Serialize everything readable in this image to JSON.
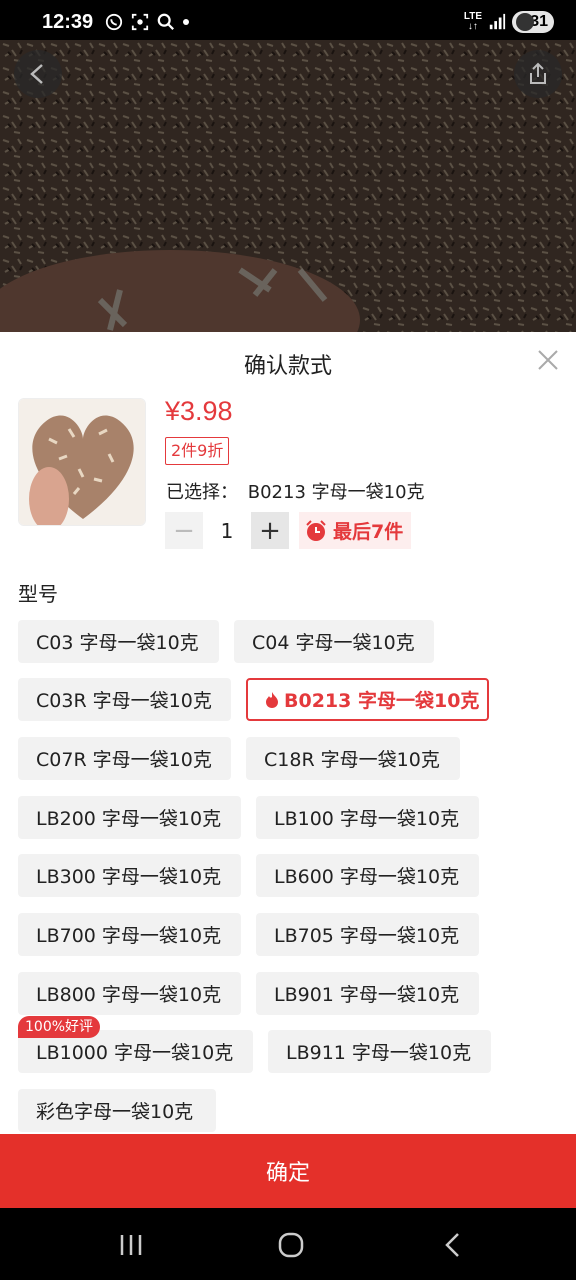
{
  "status": {
    "time": "12:39",
    "network": "LTE",
    "battery": "31",
    "icons_left": [
      "whatsapp-icon",
      "screenshot-icon",
      "search-icon",
      "dot-icon"
    ],
    "icons_right": [
      "lte-icon",
      "signal-icon",
      "battery-icon"
    ]
  },
  "hero": {
    "back_icon": "chevron-left-icon",
    "share_icon": "share-icon"
  },
  "sheet": {
    "title": "确认款式",
    "close_icon": "close-icon",
    "price": "¥3.98",
    "discount": "2件9折",
    "selected_label": "已选择：",
    "selected_value": "B0213 字母一袋10克",
    "quantity": "1",
    "minus_label": "−",
    "plus_label": "+",
    "stock": "最后7件",
    "section_label": "型号",
    "options": [
      {
        "label": "C03 字母一袋10克"
      },
      {
        "label": "C04 字母一袋10克"
      },
      {
        "label": "C03R 字母一袋10克"
      },
      {
        "label": "B0213 字母一袋10克",
        "selected": true
      },
      {
        "label": "C07R 字母一袋10克"
      },
      {
        "label": "C18R 字母一袋10克"
      },
      {
        "label": "LB200 字母一袋10克"
      },
      {
        "label": "LB100 字母一袋10克"
      },
      {
        "label": "LB300 字母一袋10克"
      },
      {
        "label": "LB600 字母一袋10克"
      },
      {
        "label": "LB700 字母一袋10克"
      },
      {
        "label": "LB705 字母一袋10克"
      },
      {
        "label": "LB800 字母一袋10克"
      },
      {
        "label": "LB901 字母一袋10克"
      },
      {
        "label": "LB1000 字母一袋10克",
        "badge": "100%好评"
      },
      {
        "label": "LB911 字母一袋10克"
      },
      {
        "label": "彩色字母一袋10克"
      }
    ],
    "confirm_label": "确定"
  },
  "colors": {
    "accent": "#e4393c",
    "confirm": "#e4302a"
  }
}
